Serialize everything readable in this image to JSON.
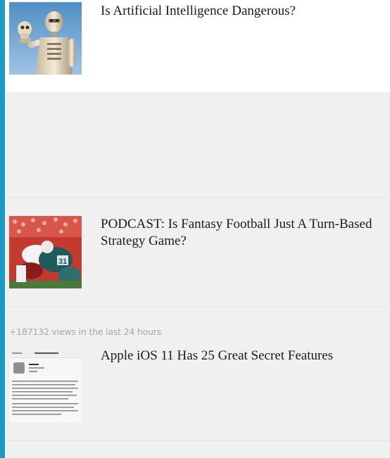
{
  "articles": [
    {
      "title": "Is Artificial Intelligence Dangerous?",
      "thumbnail_icon": "robot-skull-thumbnail"
    },
    {
      "title": "PODCAST: Is Fantasy Football Just A Turn-Based Strategy Game?",
      "thumbnail_icon": "football-tackle-thumbnail"
    },
    {
      "views": "+187132 views in the last 24 hours",
      "title": "Apple iOS 11 Has 25 Great Secret Features",
      "thumbnail_icon": "ios-settings-screenshot-thumbnail"
    }
  ],
  "colors": {
    "accent": "#1a9bc6",
    "background": "#f0f0f0",
    "card": "#ffffff",
    "views_text": "#a8a8a8"
  }
}
